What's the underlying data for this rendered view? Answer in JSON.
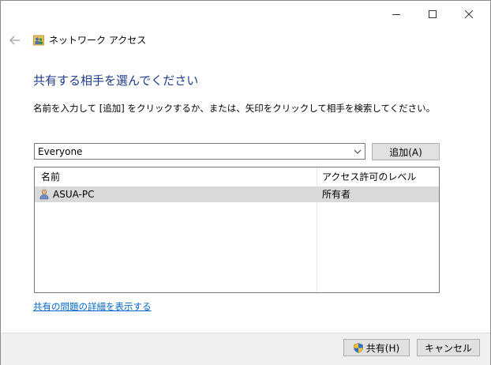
{
  "window": {
    "minimize_glyph": "—",
    "maximize_glyph": "☐",
    "close_glyph": "✕"
  },
  "nav": {
    "title": "ネットワーク アクセス"
  },
  "dialog": {
    "heading": "共有する相手を選んでください",
    "instruction": "名前を入力して [追加] をクリックするか、または、矢印をクリックして相手を検索してください。",
    "combo_value": "Everyone",
    "add_button": "追加(A)"
  },
  "list": {
    "columns": [
      "名前",
      "アクセス許可のレベル"
    ],
    "rows": [
      {
        "name": "ASUA-PC",
        "permission": "所有者",
        "icon": "user-icon"
      }
    ],
    "selected_row_color": "#d9d9d9"
  },
  "help_link": "共有の問題の詳細を表示する",
  "footer": {
    "share_button": "共有(H)",
    "cancel_button": "キャンセル"
  },
  "colors": {
    "heading": "#1e3c8c",
    "link": "#0066cc",
    "footer_bg": "#f0f0f0"
  }
}
